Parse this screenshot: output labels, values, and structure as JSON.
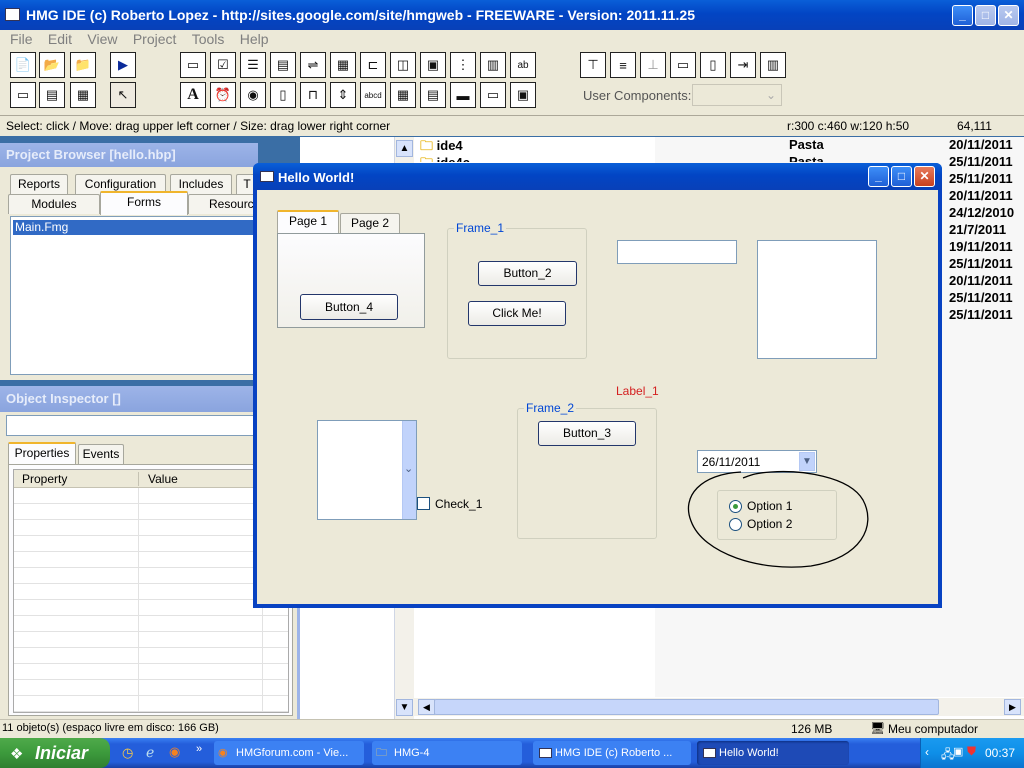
{
  "ide": {
    "title": "HMG IDE (c) Roberto Lopez - http://sites.google.com/site/hmgweb - FREEWARE - Version: 2011.11.25",
    "menu": [
      "File",
      "Edit",
      "View",
      "Project",
      "Tools",
      "Help"
    ],
    "toolbar_row1": [
      "new-file-icon",
      "open-folder-icon",
      "folder-icon",
      "run-icon"
    ],
    "toolbar_row2": [
      "form-icon",
      "page-icon",
      "grid-icon",
      "pointer-icon"
    ],
    "controls_row1": [
      "button-ctrl-icon",
      "checkbox-ctrl-icon",
      "list-ctrl-icon",
      "combo-ctrl-icon",
      "datepicker-ctrl-icon",
      "grid-ctrl-icon",
      "label-ctrl-icon",
      "frame-ctrl-icon",
      "image-ctrl-icon",
      "tree-ctrl-icon",
      "month-ctrl-icon",
      "textbox-ctrl-icon"
    ],
    "controls_row2": [
      "label-a-icon",
      "timer-icon",
      "radio-ctrl-icon",
      "editbox-ctrl-icon",
      "tab-ctrl-icon",
      "spinner-ctrl-icon",
      "hyperlink-ctrl-icon",
      "calendar-ctrl-icon",
      "browse-ctrl-icon",
      "progress-ctrl-icon",
      "slider-ctrl-icon",
      "richedit-ctrl-icon"
    ],
    "layout_buttons": [
      "align-top-icon",
      "align-middle-icon",
      "align-bottom-icon",
      "same-width-icon",
      "same-height-icon",
      "tab-order-icon",
      "properties-icon"
    ],
    "user_components_label": "User Components:",
    "status_hint": "Select: click / Move: drag upper left corner / Size: drag lower right corner",
    "status_geometry": "r:300 c:460 w:120 h:50",
    "status_position": "64,111"
  },
  "project_browser": {
    "title": "Project Browser [hello.hbp]",
    "tabs_row1": [
      "Reports",
      "Configuration",
      "Includes",
      "T"
    ],
    "tabs_row2": [
      "Modules",
      "Forms",
      "Resourc"
    ],
    "active_tab": "Forms",
    "items": [
      "Main.Fmg"
    ]
  },
  "object_inspector": {
    "title": "Object Inspector []",
    "tabs": [
      "Properties",
      "Events"
    ],
    "col_property": "Property",
    "col_value": "Value"
  },
  "explorer": {
    "files": [
      {
        "name": "ide4",
        "type": "Pasta",
        "date": "20/11/2011"
      },
      {
        "name": "ide4c",
        "type": "Pasta",
        "date": "25/11/2011"
      },
      {
        "name": "",
        "type": "",
        "date": "25/11/2011"
      },
      {
        "name": "",
        "type": "",
        "date": "20/11/2011"
      },
      {
        "name": "",
        "type": "",
        "date": "24/12/2010"
      },
      {
        "name": "",
        "type": "",
        "date": "21/7/2011"
      },
      {
        "name": "",
        "type": "",
        "date": "19/11/2011"
      },
      {
        "name": "",
        "type": "",
        "date": "25/11/2011"
      },
      {
        "name": "",
        "type": "",
        "date": "20/11/2011"
      },
      {
        "name": "",
        "type": "",
        "date": "25/11/2011"
      },
      {
        "name": "",
        "type": "",
        "date": "25/11/2011"
      }
    ],
    "status_left": "11 objeto(s) (espaço livre em disco: 166 GB)",
    "status_size": "126 MB",
    "status_location": "Meu computador"
  },
  "form": {
    "title": "Hello World!",
    "tab_page1": "Page 1",
    "tab_page2": "Page 2",
    "button4": "Button_4",
    "frame1": "Frame_1",
    "button2": "Button_2",
    "clickme": "Click Me!",
    "label1": "Label_1",
    "label1_color": "#d42020",
    "frame2": "Frame_2",
    "button3": "Button_3",
    "check1": "Check_1",
    "date": "26/11/2011",
    "option1": "Option 1",
    "option2": "Option 2"
  },
  "taskbar": {
    "start": "Iniciar",
    "tasks": [
      "HMGforum.com - Vie...",
      "HMG-4",
      "HMG IDE (c) Roberto ...",
      "Hello World!"
    ],
    "clock": "00:37"
  },
  "colors": {
    "xp_blue": "#0a5fd8",
    "dialog_face": "#ece9d8",
    "frame_caption": "#0046d5",
    "start_green": "#3c9a3c"
  }
}
